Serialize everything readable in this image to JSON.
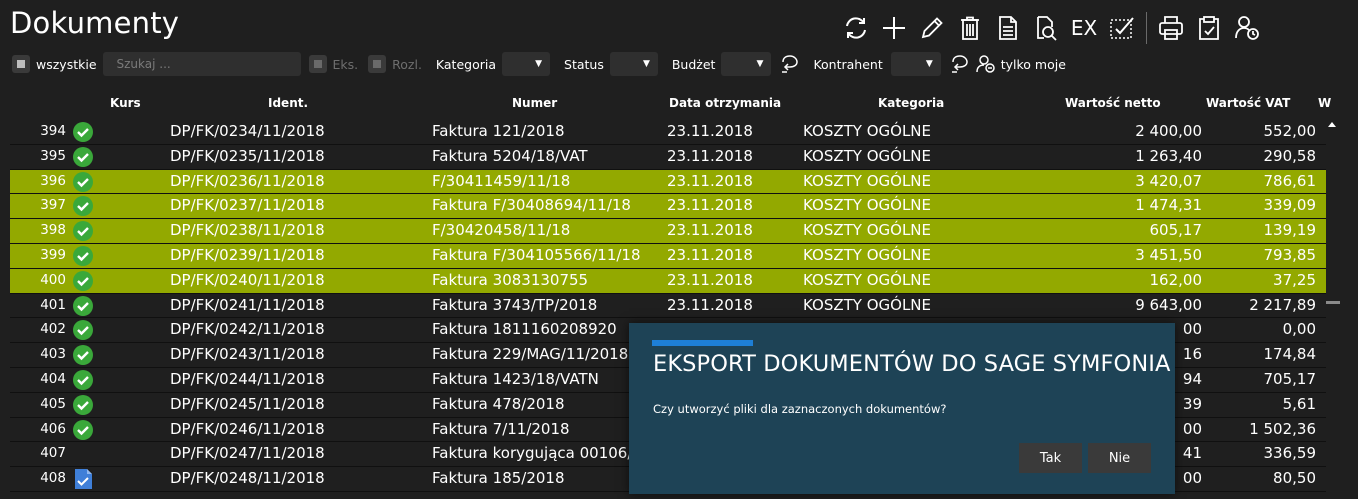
{
  "title": "Dokumenty",
  "toolbar": {
    "export_label": "EX",
    "icons": [
      "refresh-icon",
      "add-icon",
      "edit-icon",
      "delete-icon",
      "document-icon",
      "preview-search-icon",
      "export-text",
      "check-all-icon",
      "print-icon",
      "clipboard-icon",
      "user-clock-icon"
    ]
  },
  "filters": {
    "all_label": "wszystkie",
    "search_placeholder": "Szukaj ...",
    "eks_label": "Eks.",
    "rozl_label": "Rozl.",
    "category_label": "Kategoria",
    "status_label": "Status",
    "budget_label": "Budżet",
    "contractor_label": "Kontrahent",
    "only_mine_label": "tylko moje"
  },
  "columns": {
    "kurs": "Kurs",
    "ident": "Ident.",
    "numer": "Numer",
    "data": "Data otrzymania",
    "kategoria": "Kategoria",
    "netto": "Wartość netto",
    "vat": "Wartość VAT",
    "extra": "W"
  },
  "rows": [
    {
      "no": "394",
      "status": "check",
      "ident": "DP/FK/0234/11/2018",
      "numer": "Faktura 121/2018",
      "data": "23.11.2018",
      "kategoria": "KOSZTY OGÓLNE",
      "netto": "2 400,00",
      "vat": "552,00",
      "selected": false
    },
    {
      "no": "395",
      "status": "check",
      "ident": "DP/FK/0235/11/2018",
      "numer": "Faktura 5204/18/VAT",
      "data": "23.11.2018",
      "kategoria": "KOSZTY OGÓLNE",
      "netto": "1 263,40",
      "vat": "290,58",
      "selected": false
    },
    {
      "no": "396",
      "status": "check",
      "ident": "DP/FK/0236/11/2018",
      "numer": "F/30411459/11/18",
      "data": "23.11.2018",
      "kategoria": "KOSZTY OGÓLNE",
      "netto": "3 420,07",
      "vat": "786,61",
      "selected": true
    },
    {
      "no": "397",
      "status": "check",
      "ident": "DP/FK/0237/11/2018",
      "numer": "Faktura F/30408694/11/18",
      "data": "23.11.2018",
      "kategoria": "KOSZTY OGÓLNE",
      "netto": "1 474,31",
      "vat": "339,09",
      "selected": true
    },
    {
      "no": "398",
      "status": "check",
      "ident": "DP/FK/0238/11/2018",
      "numer": "F/30420458/11/18",
      "data": "23.11.2018",
      "kategoria": "KOSZTY OGÓLNE",
      "netto": "605,17",
      "vat": "139,19",
      "selected": true
    },
    {
      "no": "399",
      "status": "check",
      "ident": "DP/FK/0239/11/2018",
      "numer": "Faktura F/304105566/11/18",
      "data": "23.11.2018",
      "kategoria": "KOSZTY OGÓLNE",
      "netto": "3 451,50",
      "vat": "793,85",
      "selected": true
    },
    {
      "no": "400",
      "status": "check",
      "ident": "DP/FK/0240/11/2018",
      "numer": "Faktura 3083130755",
      "data": "23.11.2018",
      "kategoria": "KOSZTY OGÓLNE",
      "netto": "162,00",
      "vat": "37,25",
      "selected": true
    },
    {
      "no": "401",
      "status": "check",
      "ident": "DP/FK/0241/11/2018",
      "numer": "Faktura 3743/TP/2018",
      "data": "23.11.2018",
      "kategoria": "KOSZTY OGÓLNE",
      "netto": "9 643,00",
      "vat": "2 217,89",
      "selected": false
    },
    {
      "no": "402",
      "status": "check",
      "ident": "DP/FK/0242/11/2018",
      "numer": "Faktura 1811160208920",
      "data": "",
      "kategoria": "",
      "netto": "00",
      "vat": "0,00",
      "selected": false
    },
    {
      "no": "403",
      "status": "check",
      "ident": "DP/FK/0243/11/2018",
      "numer": "Faktura 229/MAG/11/2018",
      "data": "",
      "kategoria": "",
      "netto": "16",
      "vat": "174,84",
      "selected": false
    },
    {
      "no": "404",
      "status": "check",
      "ident": "DP/FK/0244/11/2018",
      "numer": "Faktura 1423/18/VATN",
      "data": "",
      "kategoria": "",
      "netto": "94",
      "vat": "705,17",
      "selected": false
    },
    {
      "no": "405",
      "status": "check",
      "ident": "DP/FK/0245/11/2018",
      "numer": "Faktura 478/2018",
      "data": "",
      "kategoria": "",
      "netto": "39",
      "vat": "5,61",
      "selected": false
    },
    {
      "no": "406",
      "status": "check",
      "ident": "DP/FK/0246/11/2018",
      "numer": "Faktura 7/11/2018",
      "data": "",
      "kategoria": "",
      "netto": "00",
      "vat": "1 502,36",
      "selected": false
    },
    {
      "no": "407",
      "status": "none",
      "ident": "DP/FK/0247/11/2018",
      "numer": "Faktura korygująca 00106/20",
      "data": "",
      "kategoria": "",
      "netto": "41",
      "vat": "336,59",
      "selected": false
    },
    {
      "no": "408",
      "status": "doc",
      "ident": "DP/FK/0248/11/2018",
      "numer": "Faktura 185/2018",
      "data": "",
      "kategoria": "",
      "netto": "00",
      "vat": "80,50",
      "selected": false
    }
  ],
  "dialog": {
    "title": "EKSPORT DOKUMENTÓW DO SAGE SYMFONIA",
    "message": "Czy utworzyć pliki dla zaznaczonych dokumentów?",
    "yes_label": "Tak",
    "no_label": "Nie"
  },
  "colors": {
    "background": "#1f1f1f",
    "selected_row": "#93a900",
    "status_ok": "#3aa83a",
    "dialog_bg": "#1e4356",
    "dialog_accent": "#1e7fd6"
  }
}
